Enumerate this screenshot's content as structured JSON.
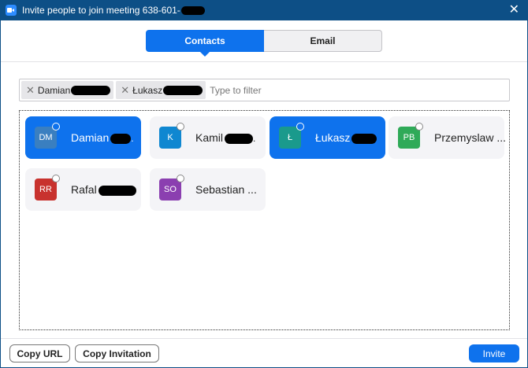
{
  "window": {
    "title": "Invite people to join meeting 638-601-",
    "close_glyph": "✕"
  },
  "tabs": [
    {
      "label": "Contacts",
      "active": true
    },
    {
      "label": "Email",
      "active": false
    }
  ],
  "filter": {
    "chips": [
      {
        "label": "Damian"
      },
      {
        "label": "Łukasz"
      }
    ],
    "chip_remove_glyph": "✕",
    "placeholder": "Type to filter"
  },
  "contacts": [
    {
      "initials": "DM",
      "name": "Damian",
      "suffix": ".",
      "selected": true,
      "color": "#3a7fc0",
      "redacted": true
    },
    {
      "initials": "K",
      "name": "Kamil",
      "suffix": ".",
      "selected": false,
      "color": "#0f87d1",
      "redacted": true
    },
    {
      "initials": "Ł",
      "name": "Łukasz",
      "suffix": "",
      "selected": true,
      "color": "#1a9a8c",
      "redacted": true
    },
    {
      "initials": "PB",
      "name": "Przemyslaw ...",
      "suffix": "",
      "selected": false,
      "color": "#2faa58",
      "redacted": false
    },
    {
      "initials": "RR",
      "name": "Rafal",
      "suffix": "",
      "selected": false,
      "color": "#c8322e",
      "redacted": true
    },
    {
      "initials": "SO",
      "name": "Sebastian ...",
      "suffix": "",
      "selected": false,
      "color": "#8b3fb0",
      "redacted": false
    }
  ],
  "footer": {
    "copy_url_label": "Copy URL",
    "copy_invitation_label": "Copy Invitation",
    "invite_label": "Invite"
  },
  "colors": {
    "titlebar": "#0d4f86",
    "accent": "#0e72ed"
  }
}
